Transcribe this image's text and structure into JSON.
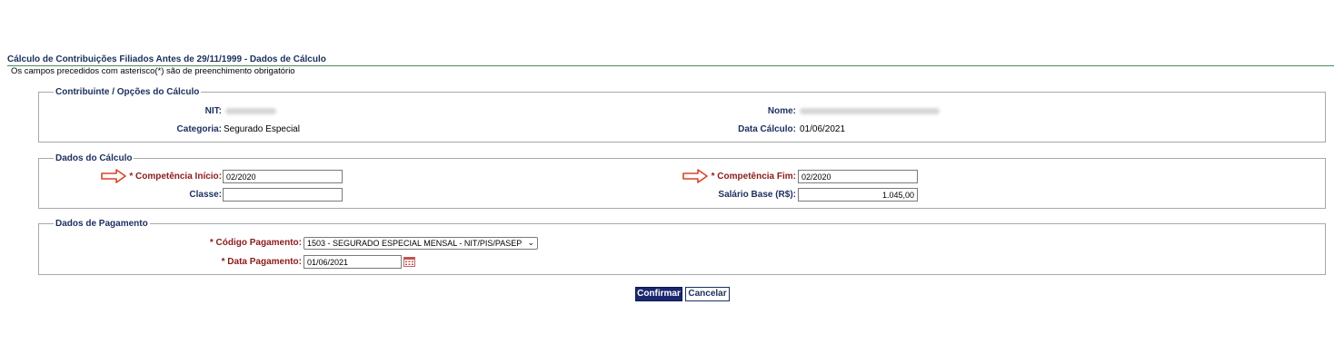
{
  "page": {
    "title": "Cálculo de Contribuições Filiados Antes de 29/11/1999 - Dados de Cálculo",
    "subtitle": "Os campos precedidos com asterisco(*) são de preenchimento obrigatório"
  },
  "contribuinte": {
    "legend": "Contribuinte / Opções do Cálculo",
    "nit_label": "NIT:",
    "nome_label": "Nome:",
    "categoria_label": "Categoria:",
    "categoria_value": "Segurado Especial",
    "data_calculo_label": "Data Cálculo:",
    "data_calculo_value": "01/06/2021"
  },
  "dados_calculo": {
    "legend": "Dados do Cálculo",
    "competencia_inicio_label": "* Competência Início:",
    "competencia_inicio_value": "02/2020",
    "competencia_fim_label": "* Competência Fim:",
    "competencia_fim_value": "02/2020",
    "classe_label": "Classe:",
    "classe_value": "",
    "salario_base_label": "Salário Base (R$):",
    "salario_base_value": "1.045,00"
  },
  "dados_pagamento": {
    "legend": "Dados de Pagamento",
    "codigo_pagamento_label": "* Código Pagamento:",
    "codigo_pagamento_value": "1503 - SEGURADO ESPECIAL MENSAL - NIT/PIS/PASEP",
    "data_pagamento_label": "* Data Pagamento:",
    "data_pagamento_value": "01/06/2021"
  },
  "actions": {
    "confirm_label": "Confirmar",
    "cancel_label": "Cancelar"
  },
  "icons": {
    "arrow": "right-arrow-icon",
    "calendar": "calendar-icon",
    "dropdown": "chevron-down-icon"
  },
  "colors": {
    "label_blue": "#1b2f5e",
    "required_red": "#8b1a1a",
    "arrow_red": "#d9432a",
    "confirm_bg": "#1a2870"
  }
}
